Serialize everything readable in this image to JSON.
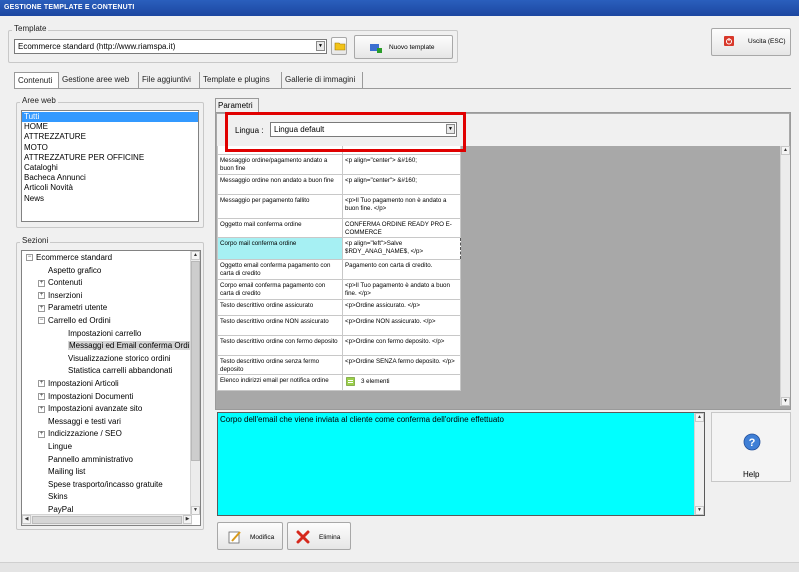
{
  "window": {
    "title": "GESTIONE TEMPLATE E CONTENUTI"
  },
  "template": {
    "group_label": "Template",
    "selected": "Ecommerce standard (http://www.riamspa.it)",
    "new_button": "Nuovo template"
  },
  "exit_button": "Uscita (ESC)",
  "tabs": [
    {
      "label": "Contenuti",
      "active": true
    },
    {
      "label": "Gestione aree web"
    },
    {
      "label": "File aggiuntivi"
    },
    {
      "label": "Template e plugins"
    },
    {
      "label": "Gallerie di immagini"
    }
  ],
  "aree_web": {
    "label": "Aree web",
    "items": [
      "Tutti",
      "HOME",
      "ATTREZZATURE",
      "MOTO",
      "ATTREZZATURE PER OFFICINE",
      "Cataloghi",
      "Bacheca Annunci",
      "Articoli Novità",
      "News"
    ]
  },
  "sezioni": {
    "label": "Sezioni",
    "items": [
      {
        "label": "Ecommerce standard",
        "level": 0,
        "expander": "-"
      },
      {
        "label": "Aspetto grafico",
        "level": 1,
        "expander": ""
      },
      {
        "label": "Contenuti",
        "level": 1,
        "expander": "+"
      },
      {
        "label": "Inserzioni",
        "level": 1,
        "expander": "+"
      },
      {
        "label": "Parametri utente",
        "level": 1,
        "expander": "+"
      },
      {
        "label": "Carrello ed Ordini",
        "level": 1,
        "expander": "-"
      },
      {
        "label": "Impostazioni carrello",
        "level": 2,
        "expander": ""
      },
      {
        "label": "Messaggi ed Email conferma Ordini",
        "level": 2,
        "expander": "",
        "selected": true
      },
      {
        "label": "Visualizzazione storico ordini",
        "level": 2,
        "expander": ""
      },
      {
        "label": "Statistica carrelli abbandonati",
        "level": 2,
        "expander": ""
      },
      {
        "label": "Impostazioni Articoli",
        "level": 1,
        "expander": "+"
      },
      {
        "label": "Impostazioni Documenti",
        "level": 1,
        "expander": "+"
      },
      {
        "label": "Impostazioni avanzate sito",
        "level": 1,
        "expander": "+"
      },
      {
        "label": "Messaggi e testi vari",
        "level": 1,
        "expander": ""
      },
      {
        "label": "Indicizzazione / SEO",
        "level": 1,
        "expander": "+"
      },
      {
        "label": "Lingue",
        "level": 1,
        "expander": ""
      },
      {
        "label": "Pannello amministrativo",
        "level": 1,
        "expander": ""
      },
      {
        "label": "Mailing list",
        "level": 1,
        "expander": ""
      },
      {
        "label": "Spese trasporto/incasso gratuite",
        "level": 1,
        "expander": ""
      },
      {
        "label": "Skins",
        "level": 1,
        "expander": ""
      },
      {
        "label": "PayPal",
        "level": 1,
        "expander": ""
      }
    ]
  },
  "parametri": {
    "tab_label": "Parametri",
    "lingua_label": "Lingua :",
    "lingua_value": "Lingua default",
    "rows": [
      {
        "name": "Messaggio ordine/pagamento andato a buon fine",
        "value": "<p align=\"center\"> &#160;"
      },
      {
        "name": "Messaggio ordine non andato a buon fine",
        "value": "<p align=\"center\"> &#160;"
      },
      {
        "name": "Messaggio per pagamento fallito",
        "value": "<p>Il Tuo pagamento non è andato a buon fine. </p>"
      },
      {
        "name": "Oggetto mail conferma ordine",
        "value": "CONFERMA ORDINE READY PRO E-COMMERCE"
      },
      {
        "name": "Corpo mail conferma ordine",
        "value": "<p align=\"left\">Salve $RDY_ANAG_NAME$, </p>",
        "selected": true
      },
      {
        "name": "Oggetto email conferma pagamento con carta di credito",
        "value": "Pagamento con carta di credito."
      },
      {
        "name": "Corpo email conferma pagamento con carta di credito",
        "value": "<p>Il Tuo pagamento è andato a buon fine. </p>"
      },
      {
        "name": "Testo descrittivo ordine assicurato",
        "value": "<p>Ordine assicurato. </p>"
      },
      {
        "name": "Testo descrittivo ordine NON assicurato",
        "value": "<p>Ordine NON assicurato. </p>"
      },
      {
        "name": "Testo descrittivo ordine con fermo deposito",
        "value": "<p>Ordine con fermo deposito. </p>"
      },
      {
        "name": "Testo descrittivo ordine senza fermo deposito",
        "value": "<p>Ordine SENZA fermo deposito. </p>"
      },
      {
        "name": "Elenco indirizzi email per notifica ordine",
        "value": "3 elementi"
      }
    ],
    "description": "Corpo dell'email che viene inviata al cliente come conferma dell'ordine effettuato"
  },
  "help_button": "Help",
  "modifica_button": "Modifica",
  "elimina_button": "Elimina",
  "colors": {
    "titlebar": "#1c46a0",
    "selection": "#3399ff",
    "description_bg": "#00ffff",
    "highlight": "#e00000"
  }
}
